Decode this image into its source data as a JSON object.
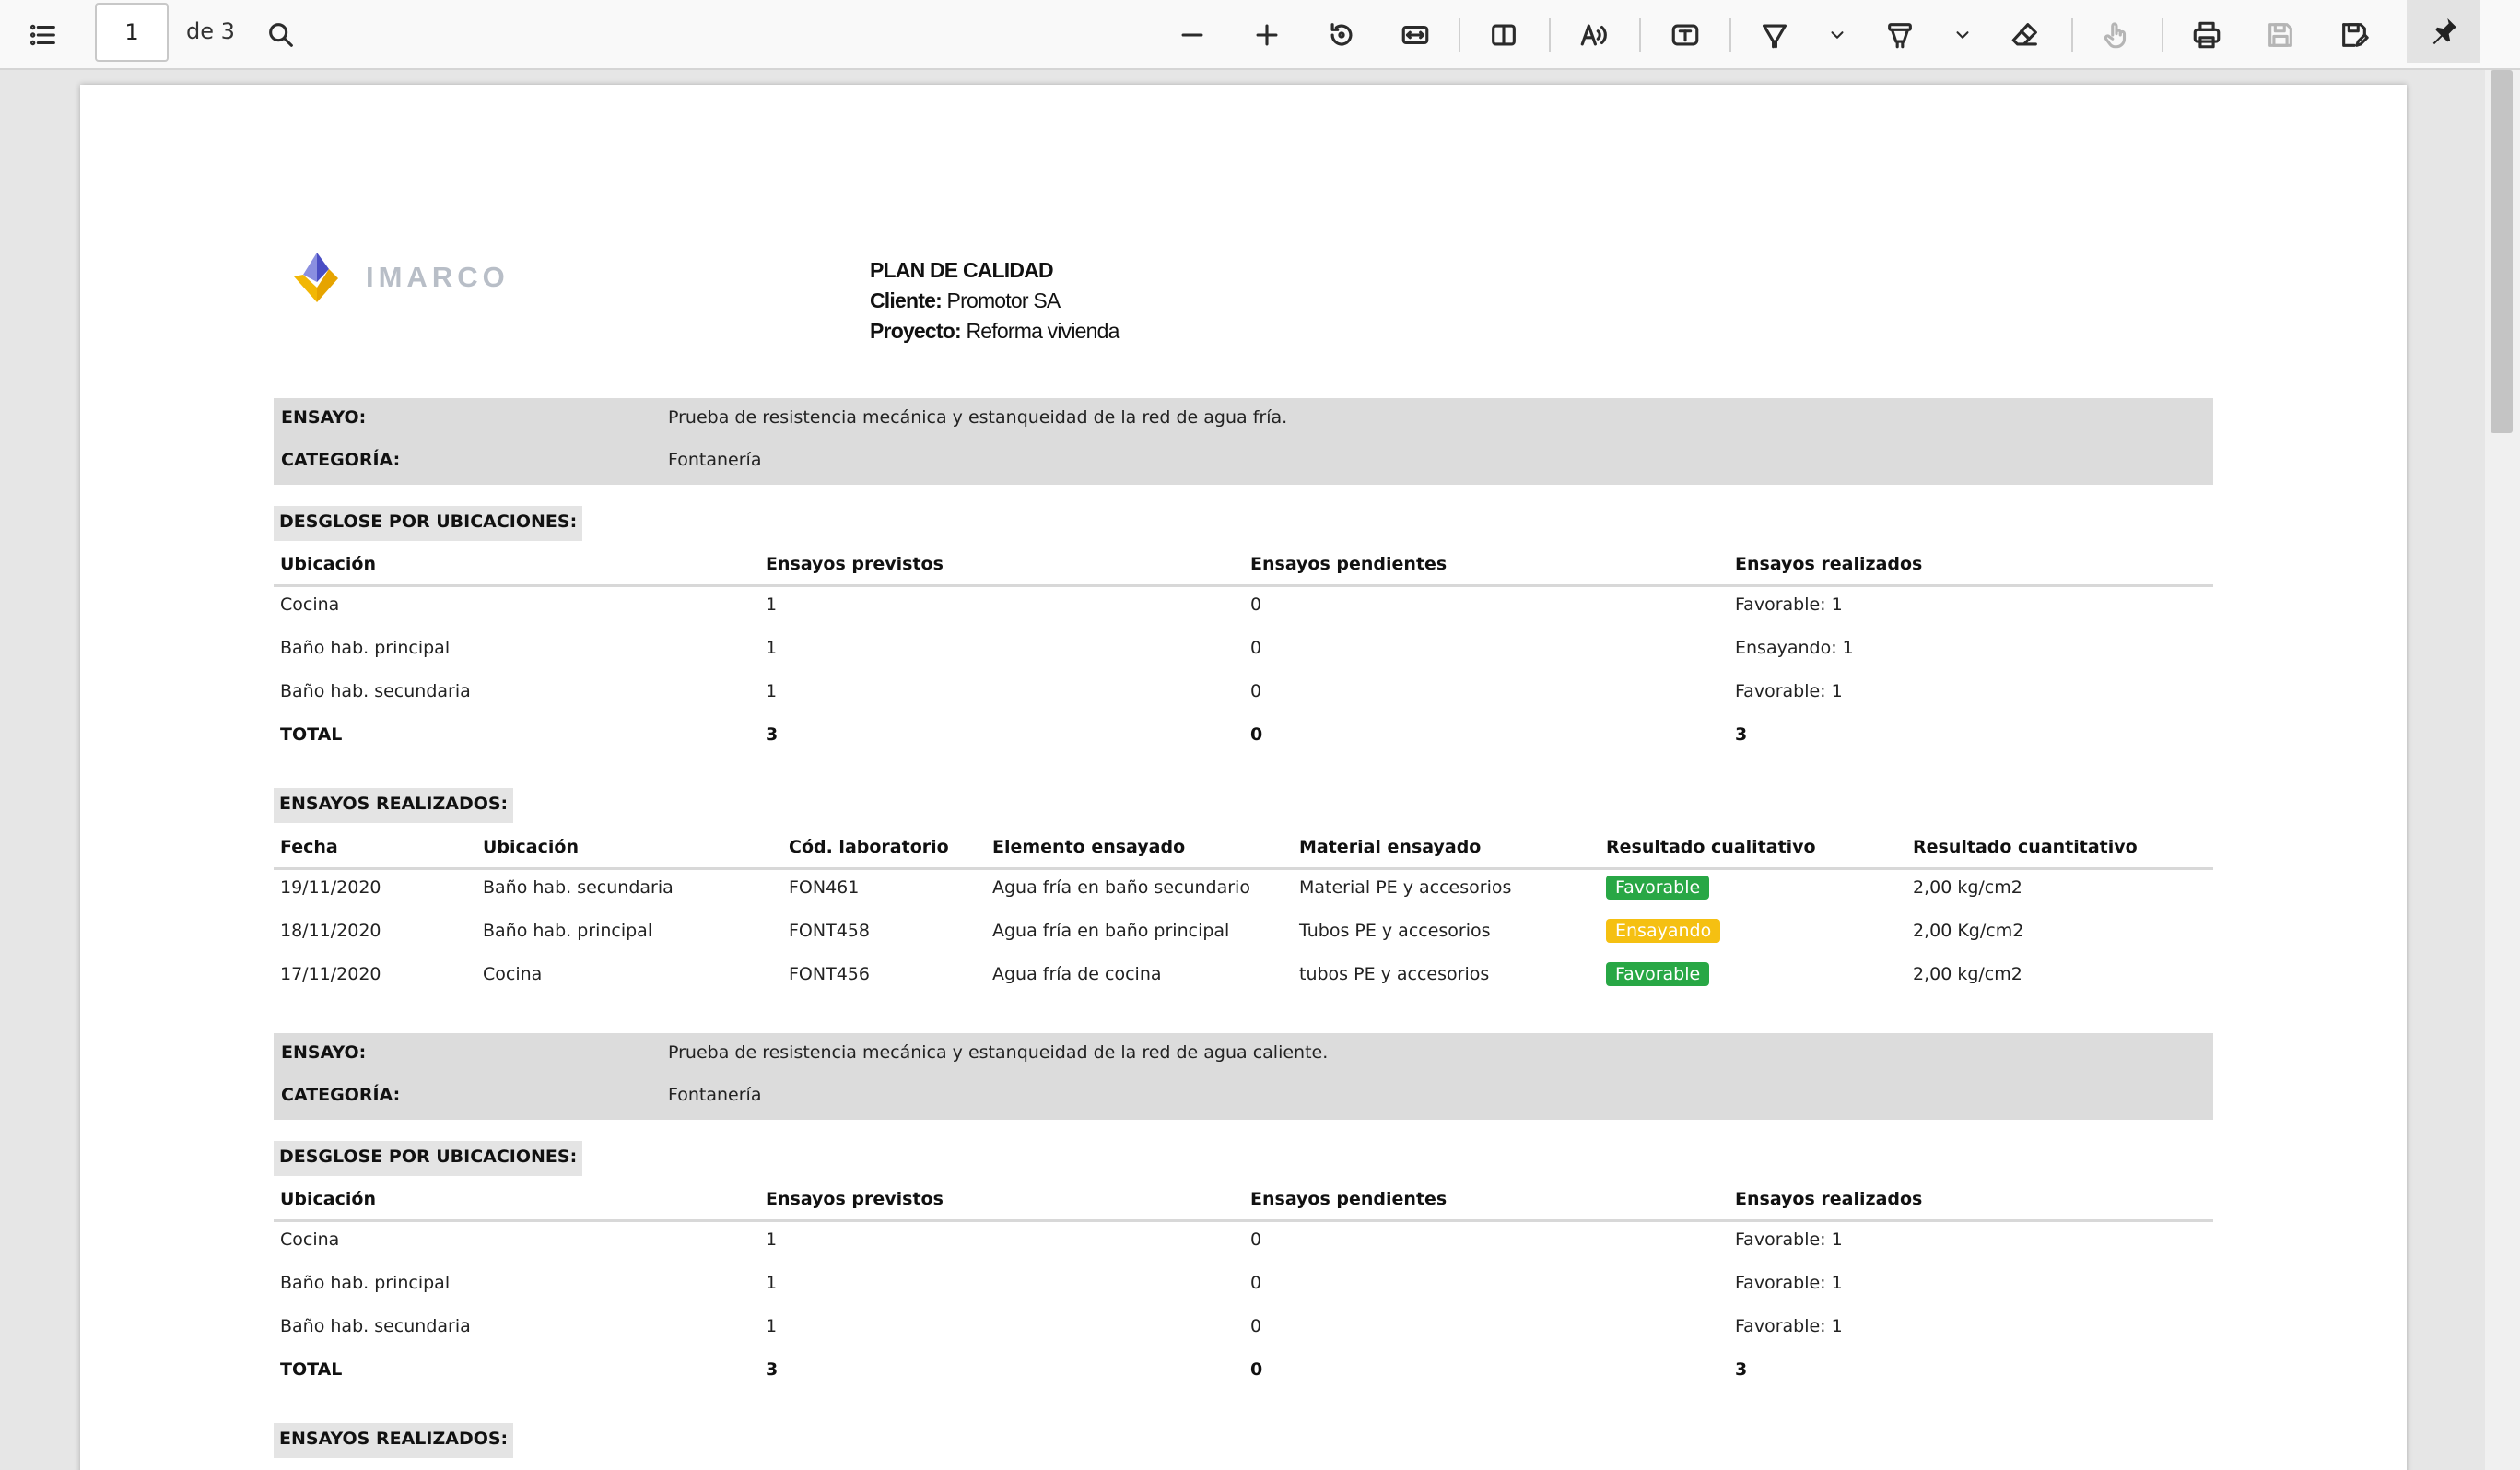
{
  "toolbar": {
    "page_current": "1",
    "page_total": "de 3",
    "icons": [
      "list-icon",
      "search-icon",
      "zoom-out-icon",
      "zoom-in-icon",
      "rotate-icon",
      "fit-width-icon",
      "page-view-icon",
      "read-aloud-icon",
      "text-box-icon",
      "highlight-icon",
      "chevron-down-icon",
      "draw-icon",
      "chevron-down-icon",
      "eraser-icon",
      "touch-icon",
      "print-icon",
      "save-icon",
      "save-as-icon",
      "pin-icon"
    ]
  },
  "header": {
    "logo_text": "IMARCO",
    "plan": "PLAN DE CALIDAD",
    "cliente_label": "Cliente:",
    "cliente_value": "Promotor SA",
    "proyecto_label": "Proyecto:",
    "proyecto_value": "Reforma vivienda"
  },
  "blocks": [
    {
      "ensayo_label": "ENSAYO:",
      "ensayo_value": "Prueba de resistencia mecánica y estanqueidad de la red de agua fría.",
      "categoria_label": "CATEGORÍA:",
      "categoria_value": "Fontanería",
      "desglose_title": "DESGLOSE POR UBICACIONES:",
      "desglose_headers": [
        "Ubicación",
        "Ensayos previstos",
        "Ensayos pendientes",
        "Ensayos realizados"
      ],
      "desglose_rows": [
        [
          "Cocina",
          "1",
          "0",
          "Favorable: 1"
        ],
        [
          "Baño hab. principal",
          "1",
          "0",
          "Ensayando: 1"
        ],
        [
          "Baño hab. secundaria",
          "1",
          "0",
          "Favorable: 1"
        ]
      ],
      "desglose_total": [
        "TOTAL",
        "3",
        "0",
        "3"
      ],
      "realizados_title": "ENSAYOS REALIZADOS:",
      "realizados_headers": [
        "Fecha",
        "Ubicación",
        "Cód. laboratorio",
        "Elemento ensayado",
        "Material ensayado",
        "Resultado cualitativo",
        "Resultado cuantitativo"
      ],
      "realizados_rows": [
        [
          "19/11/2020",
          "Baño hab. secundaria",
          "FON461",
          "Agua fría en baño secundario",
          "Material PE y accesorios",
          "Favorable",
          "2,00 kg/cm2"
        ],
        [
          "18/11/2020",
          "Baño hab. principal",
          "FONT458",
          "Agua fría en baño principal",
          "Tubos PE y accesorios",
          "Ensayando",
          "2,00 Kg/cm2"
        ],
        [
          "17/11/2020",
          "Cocina",
          "FONT456",
          "Agua fría de cocina",
          "tubos PE y accesorios",
          "Favorable",
          "2,00 kg/cm2"
        ]
      ]
    },
    {
      "ensayo_label": "ENSAYO:",
      "ensayo_value": "Prueba de resistencia mecánica y estanqueidad de la red de agua caliente.",
      "categoria_label": "CATEGORÍA:",
      "categoria_value": "Fontanería",
      "desglose_title": "DESGLOSE POR UBICACIONES:",
      "desglose_headers": [
        "Ubicación",
        "Ensayos previstos",
        "Ensayos pendientes",
        "Ensayos realizados"
      ],
      "desglose_rows": [
        [
          "Cocina",
          "1",
          "0",
          "Favorable: 1"
        ],
        [
          "Baño hab. principal",
          "1",
          "0",
          "Favorable: 1"
        ],
        [
          "Baño hab. secundaria",
          "1",
          "0",
          "Favorable: 1"
        ]
      ],
      "desglose_total": [
        "TOTAL",
        "3",
        "0",
        "3"
      ],
      "realizados_title": "ENSAYOS REALIZADOS:"
    }
  ],
  "colors": {
    "favorable": "#28a745",
    "ensayando": "#f5c012",
    "box": "#dcdcdc"
  }
}
